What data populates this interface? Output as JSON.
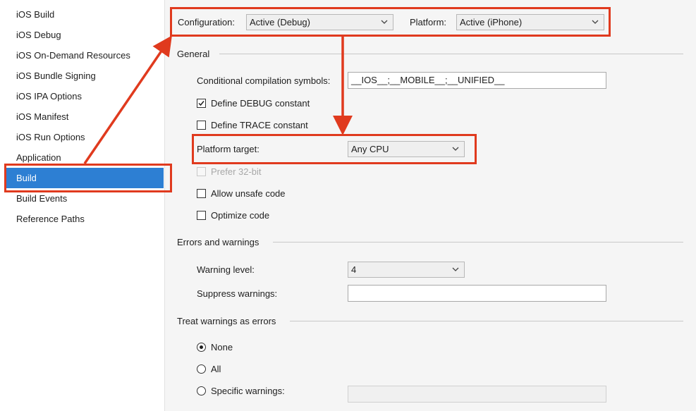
{
  "sidebar": {
    "items": [
      {
        "label": "iOS Build"
      },
      {
        "label": "iOS Debug"
      },
      {
        "label": "iOS On-Demand Resources"
      },
      {
        "label": "iOS Bundle Signing"
      },
      {
        "label": "iOS IPA Options"
      },
      {
        "label": "iOS Manifest"
      },
      {
        "label": "iOS Run Options"
      },
      {
        "label": "Application"
      },
      {
        "label": "Build",
        "selected": true
      },
      {
        "label": "Build Events"
      },
      {
        "label": "Reference Paths"
      }
    ]
  },
  "toolbar": {
    "configuration_label": "Configuration:",
    "configuration_value": "Active (Debug)",
    "platform_label": "Platform:",
    "platform_value": "Active (iPhone)"
  },
  "general": {
    "title": "General",
    "symbols_label": "Conditional compilation symbols:",
    "symbols_value": "__IOS__;__MOBILE__;__UNIFIED__",
    "define_debug_label": "Define DEBUG constant",
    "define_debug_checked": true,
    "define_trace_label": "Define TRACE constant",
    "define_trace_checked": false,
    "platform_target_label": "Platform target:",
    "platform_target_value": "Any CPU",
    "prefer32_label": "Prefer 32-bit",
    "prefer32_enabled": false,
    "unsafe_label": "Allow unsafe code",
    "unsafe_checked": false,
    "optimize_label": "Optimize code",
    "optimize_checked": false
  },
  "errors": {
    "title": "Errors and warnings",
    "warning_level_label": "Warning level:",
    "warning_level_value": "4",
    "suppress_label": "Suppress warnings:",
    "suppress_value": ""
  },
  "treat": {
    "title": "Treat warnings as errors",
    "options": [
      {
        "label": "None",
        "selected": true
      },
      {
        "label": "All",
        "selected": false
      },
      {
        "label": "Specific warnings:",
        "selected": false
      }
    ],
    "specific_value": ""
  },
  "colors": {
    "highlight": "#e03a1e",
    "selection": "#2d7fd3"
  }
}
